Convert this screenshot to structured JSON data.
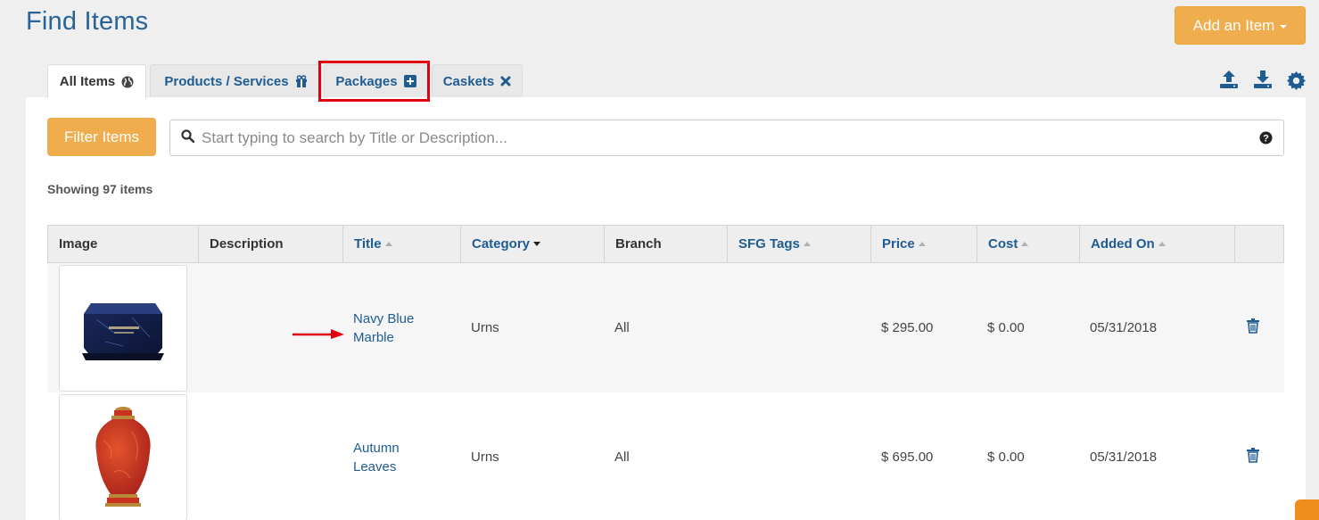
{
  "page": {
    "title": "Find Items"
  },
  "header": {
    "add_button": "Add an Item"
  },
  "tabs": [
    {
      "label": "All Items",
      "icon": "globe-icon",
      "active": true
    },
    {
      "label": "Products / Services",
      "icon": "gift-icon",
      "active": false
    },
    {
      "label": "Packages",
      "icon": "plus-square-icon",
      "active": false,
      "highlighted": true
    },
    {
      "label": "Caskets",
      "icon": "close-icon",
      "active": false
    }
  ],
  "toolbar_icons": [
    "upload-icon",
    "download-icon",
    "gear-icon"
  ],
  "filter": {
    "button_label": "Filter Items",
    "search_placeholder": "Start typing to search by Title or Description...",
    "search_value": ""
  },
  "results": {
    "showing_text": "Showing 97 items"
  },
  "table": {
    "columns": [
      {
        "label": "Image",
        "sortable": false
      },
      {
        "label": "Description",
        "sortable": false
      },
      {
        "label": "Title",
        "sortable": true,
        "sort": "none"
      },
      {
        "label": "Category",
        "sortable": true,
        "sort": "desc"
      },
      {
        "label": "Branch",
        "sortable": false
      },
      {
        "label": "SFG Tags",
        "sortable": true,
        "sort": "none"
      },
      {
        "label": "Price",
        "sortable": true,
        "sort": "none"
      },
      {
        "label": "Cost",
        "sortable": true,
        "sort": "none"
      },
      {
        "label": "Added On",
        "sortable": true,
        "sort": "none"
      },
      {
        "label": "",
        "sortable": false
      }
    ],
    "rows": [
      {
        "image": "navy-urn-image",
        "description": "",
        "title_line1": "Navy Blue",
        "title_line2": "Marble",
        "category": "Urns",
        "branch": "All",
        "sfg_tags": "",
        "price": "$ 295.00",
        "cost": "$ 0.00",
        "added_on": "05/31/2018",
        "action_icon": "trash-icon"
      },
      {
        "image": "red-urn-image",
        "description": "",
        "title_line1": "Autumn",
        "title_line2": "Leaves",
        "category": "Urns",
        "branch": "All",
        "sfg_tags": "",
        "price": "$ 695.00",
        "cost": "$ 0.00",
        "added_on": "05/31/2018",
        "action_icon": "trash-icon"
      }
    ]
  },
  "colors": {
    "accent_orange": "#f0ad4e",
    "link_blue": "#1f5c92",
    "highlight_red": "#e0000f"
  }
}
